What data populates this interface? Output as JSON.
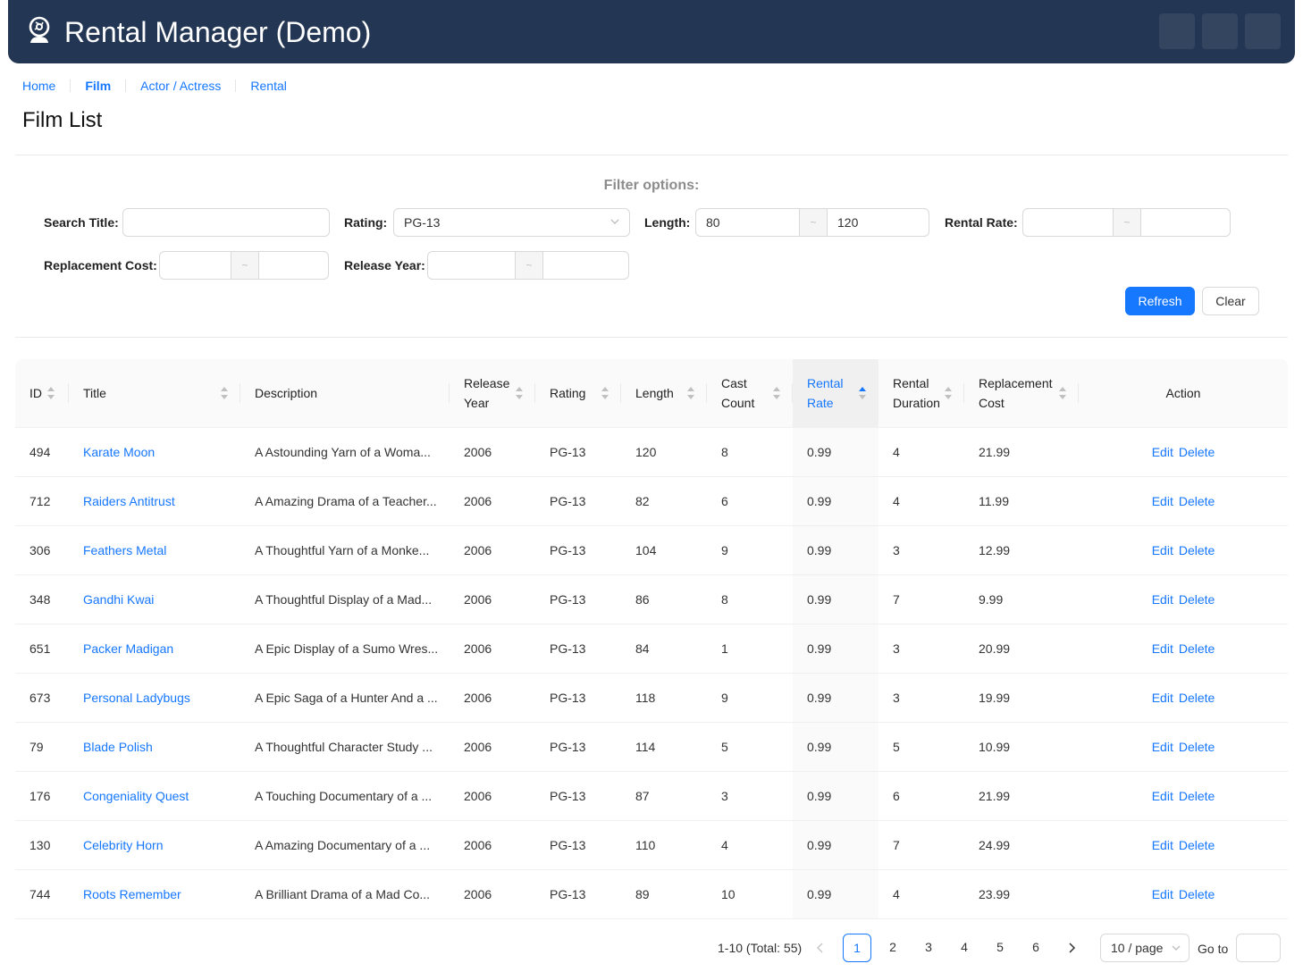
{
  "header": {
    "title": "Rental Manager (Demo)",
    "logo_icon": "camera-icon",
    "bg_color": "#233653"
  },
  "nav": {
    "items": [
      {
        "label": "Home",
        "active": false
      },
      {
        "label": "Film",
        "active": true
      },
      {
        "label": "Actor / Actress",
        "active": false
      },
      {
        "label": "Rental",
        "active": false
      }
    ]
  },
  "page_title": "Film List",
  "filters": {
    "title": "Filter options:",
    "search_title": {
      "label": "Search Title:",
      "value": ""
    },
    "rating": {
      "label": "Rating:",
      "value": "PG-13"
    },
    "length": {
      "label": "Length:",
      "min": "80",
      "max": "120",
      "separator": "~"
    },
    "rental_rate": {
      "label": "Rental Rate:",
      "min": "",
      "max": "",
      "separator": "~"
    },
    "replacement_cost": {
      "label": "Replacement Cost:",
      "min": "",
      "max": "",
      "separator": "~"
    },
    "release_year": {
      "label": "Release Year:",
      "min": "",
      "max": "",
      "separator": "~"
    },
    "refresh_label": "Refresh",
    "clear_label": "Clear"
  },
  "table": {
    "columns": [
      {
        "key": "id",
        "label": "ID",
        "sortable": true
      },
      {
        "key": "title",
        "label": "Title",
        "sortable": true
      },
      {
        "key": "description",
        "label": "Description",
        "sortable": false
      },
      {
        "key": "release_year",
        "label": "Release Year",
        "sortable": true
      },
      {
        "key": "rating",
        "label": "Rating",
        "sortable": true
      },
      {
        "key": "length",
        "label": "Length",
        "sortable": true
      },
      {
        "key": "cast_count",
        "label": "Cast Count",
        "sortable": true
      },
      {
        "key": "rental_rate",
        "label": "Rental Rate",
        "sortable": true,
        "sorted": "ascend"
      },
      {
        "key": "rental_duration",
        "label": "Rental Duration",
        "sortable": true
      },
      {
        "key": "replacement_cost",
        "label": "Replacement Cost",
        "sortable": true
      },
      {
        "key": "action",
        "label": "Action",
        "sortable": false
      }
    ],
    "edit_label": "Edit",
    "delete_label": "Delete",
    "rows": [
      {
        "id": "494",
        "title": "Karate Moon",
        "description": "A Astounding Yarn of a Woma...",
        "release_year": "2006",
        "rating": "PG-13",
        "length": "120",
        "cast_count": "8",
        "rental_rate": "0.99",
        "rental_duration": "4",
        "replacement_cost": "21.99"
      },
      {
        "id": "712",
        "title": "Raiders Antitrust",
        "description": "A Amazing Drama of a Teacher...",
        "release_year": "2006",
        "rating": "PG-13",
        "length": "82",
        "cast_count": "6",
        "rental_rate": "0.99",
        "rental_duration": "4",
        "replacement_cost": "11.99"
      },
      {
        "id": "306",
        "title": "Feathers Metal",
        "description": "A Thoughtful Yarn of a Monke...",
        "release_year": "2006",
        "rating": "PG-13",
        "length": "104",
        "cast_count": "9",
        "rental_rate": "0.99",
        "rental_duration": "3",
        "replacement_cost": "12.99"
      },
      {
        "id": "348",
        "title": "Gandhi Kwai",
        "description": "A Thoughtful Display of a Mad...",
        "release_year": "2006",
        "rating": "PG-13",
        "length": "86",
        "cast_count": "8",
        "rental_rate": "0.99",
        "rental_duration": "7",
        "replacement_cost": "9.99"
      },
      {
        "id": "651",
        "title": "Packer Madigan",
        "description": "A Epic Display of a Sumo Wres...",
        "release_year": "2006",
        "rating": "PG-13",
        "length": "84",
        "cast_count": "1",
        "rental_rate": "0.99",
        "rental_duration": "3",
        "replacement_cost": "20.99"
      },
      {
        "id": "673",
        "title": "Personal Ladybugs",
        "description": "A Epic Saga of a Hunter And a ...",
        "release_year": "2006",
        "rating": "PG-13",
        "length": "118",
        "cast_count": "9",
        "rental_rate": "0.99",
        "rental_duration": "3",
        "replacement_cost": "19.99"
      },
      {
        "id": "79",
        "title": "Blade Polish",
        "description": "A Thoughtful Character Study ...",
        "release_year": "2006",
        "rating": "PG-13",
        "length": "114",
        "cast_count": "5",
        "rental_rate": "0.99",
        "rental_duration": "5",
        "replacement_cost": "10.99"
      },
      {
        "id": "176",
        "title": "Congeniality Quest",
        "description": "A Touching Documentary of a ...",
        "release_year": "2006",
        "rating": "PG-13",
        "length": "87",
        "cast_count": "3",
        "rental_rate": "0.99",
        "rental_duration": "6",
        "replacement_cost": "21.99"
      },
      {
        "id": "130",
        "title": "Celebrity Horn",
        "description": "A Amazing Documentary of a ...",
        "release_year": "2006",
        "rating": "PG-13",
        "length": "110",
        "cast_count": "4",
        "rental_rate": "0.99",
        "rental_duration": "7",
        "replacement_cost": "24.99"
      },
      {
        "id": "744",
        "title": "Roots Remember",
        "description": "A Brilliant Drama of a Mad Co...",
        "release_year": "2006",
        "rating": "PG-13",
        "length": "89",
        "cast_count": "10",
        "rental_rate": "0.99",
        "rental_duration": "4",
        "replacement_cost": "23.99"
      }
    ]
  },
  "pagination": {
    "total_text": "1-10 (Total: 55)",
    "pages": [
      "1",
      "2",
      "3",
      "4",
      "5",
      "6"
    ],
    "current": "1",
    "page_size": "10 / page",
    "goto_label": "Go to",
    "goto_value": ""
  },
  "colors": {
    "primary": "#1677ff",
    "edit": "#389e0d",
    "delete": "#f5222d"
  }
}
